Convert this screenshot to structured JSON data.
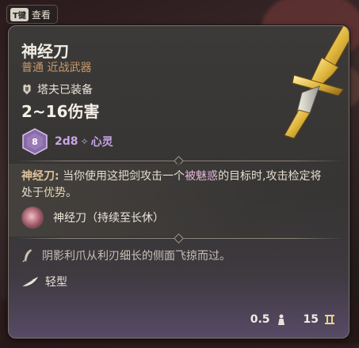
{
  "hint": {
    "key": "T键",
    "label": "查看"
  },
  "item": {
    "name": "神经刀",
    "subtitle": "普通 近战武器",
    "equipped_by": "塔夫已装备",
    "damage": "2~16伤害",
    "dice": {
      "die_label": "8",
      "roll": "2d8",
      "damage_type": "心灵",
      "die_color": "#8a6aa8"
    },
    "description": {
      "keyword": "神经刀:",
      "text_pre": "当你使用这把剑攻击一个",
      "highlight1": "被魅惑",
      "text_mid": "的目标时,攻击检定将处于",
      "highlight2": "优势",
      "text_end": "。"
    },
    "buff": {
      "label": "神经刀（持续至长休）",
      "icon": "mind-blade-status-icon"
    },
    "flavor": {
      "text": "阴影利爪从利刃细长的侧面飞掠而过。",
      "icon": "quill-icon"
    },
    "property": {
      "label": "轻型",
      "icon": "feather-icon"
    },
    "weight": "0.5",
    "value": "15"
  },
  "colors": {
    "accent_gold": "#dcc39a",
    "psychic": "#c9a4e6",
    "subtitle": "#c89a6a"
  }
}
